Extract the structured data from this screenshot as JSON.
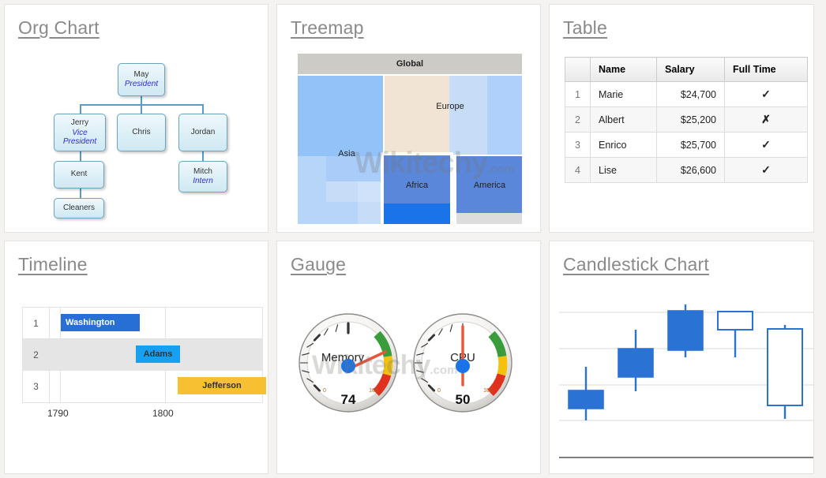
{
  "panels": {
    "org": {
      "title": "Org Chart"
    },
    "treemap": {
      "title": "Treemap"
    },
    "table": {
      "title": "Table"
    },
    "timeline": {
      "title": "Timeline"
    },
    "gauge": {
      "title": "Gauge"
    },
    "candlestick": {
      "title": "Candlestick Chart"
    }
  },
  "watermark": {
    "text": "Wikitechy",
    "sub": ".com"
  },
  "chart_data": [
    {
      "type": "diagram",
      "name": "org-chart",
      "title": "Org Chart",
      "nodes": [
        {
          "id": "May",
          "label": "May",
          "role": "President",
          "parent": null
        },
        {
          "id": "Jerry",
          "label": "Jerry",
          "role": "Vice President",
          "parent": "May"
        },
        {
          "id": "Chris",
          "label": "Chris",
          "role": "",
          "parent": "May"
        },
        {
          "id": "Jordan",
          "label": "Jordan",
          "role": "",
          "parent": "May"
        },
        {
          "id": "Kent",
          "label": "Kent",
          "role": "",
          "parent": "Jerry"
        },
        {
          "id": "Cleaners",
          "label": "Cleaners",
          "role": "",
          "parent": "Kent"
        },
        {
          "id": "Mitch",
          "label": "Mitch",
          "role": "Intern",
          "parent": "Jordan"
        }
      ]
    },
    {
      "type": "treemap",
      "name": "treemap",
      "title": "Treemap",
      "root": "Global",
      "labels": [
        "Global",
        "Asia",
        "Europe",
        "Africa",
        "America"
      ],
      "colors": {
        "header": "#cdcbc6",
        "asia": "#93c2f9",
        "europe": "#f2e4d5",
        "africa": "#5b87da",
        "america": "#5b87da",
        "deep_blue": "#1a73e8",
        "pale_blue": "#c6dcf7",
        "light_grey": "#dddddd"
      }
    },
    {
      "type": "table",
      "name": "data-table",
      "title": "Table",
      "columns": [
        "",
        "Name",
        "Salary",
        "Full Time"
      ],
      "rows": [
        {
          "index": "1",
          "name": "Marie",
          "salary": "$24,700",
          "fulltime": "✓"
        },
        {
          "index": "2",
          "name": "Albert",
          "salary": "$25,200",
          "fulltime": "✗"
        },
        {
          "index": "3",
          "name": "Enrico",
          "salary": "$25,700",
          "fulltime": "✓"
        },
        {
          "index": "4",
          "name": "Lise",
          "salary": "$26,600",
          "fulltime": "✓"
        }
      ]
    },
    {
      "type": "timeline",
      "name": "timeline",
      "title": "Timeline",
      "axis_ticks": [
        "1790",
        "1800"
      ],
      "rows": [
        {
          "index": "1",
          "label": "Washington",
          "color": "#276fd4",
          "text_color": "#ffffff",
          "start_pct": 8,
          "width_pct": 42
        },
        {
          "index": "2",
          "label": "Adams",
          "color": "#18a0f0",
          "text_color": "#333333",
          "start_pct": 48,
          "width_pct": 22
        },
        {
          "index": "3",
          "label": "Jefferson",
          "color": "#f7c032",
          "text_color": "#333333",
          "start_pct": 68,
          "width_pct": 38
        }
      ]
    },
    {
      "type": "gauge",
      "name": "gauges",
      "title": "Gauge",
      "min": 0,
      "max": 100,
      "min_label": "0",
      "max_label": "100",
      "bands": [
        {
          "name": "green",
          "color": "#3a9c3a",
          "from": 60,
          "to": 80
        },
        {
          "name": "yellow",
          "color": "#f4c20d",
          "from": 80,
          "to": 90
        },
        {
          "name": "red",
          "color": "#e0301e",
          "from": 90,
          "to": 100
        }
      ],
      "gauges": [
        {
          "label": "Memory",
          "value": 74,
          "value_text": "74"
        },
        {
          "label": "CPU",
          "value": 50,
          "value_text": "50"
        }
      ]
    },
    {
      "type": "candlestick",
      "name": "candlestick-chart",
      "title": "Candlestick Chart",
      "color": "#2a72d4",
      "gridlines": 4,
      "candles": [
        {
          "low": 10,
          "open": 26,
          "close": 34,
          "high": 48,
          "filled": true
        },
        {
          "low": 22,
          "open": 38,
          "close": 56,
          "high": 68,
          "filled": true
        },
        {
          "low": 42,
          "open": 52,
          "close": 78,
          "high": 85,
          "filled": true
        },
        {
          "low": 48,
          "open": 72,
          "close": 82,
          "high": 82,
          "filled": false
        },
        {
          "low": 8,
          "open": 70,
          "close": 22,
          "high": 74,
          "filled": false
        }
      ]
    }
  ]
}
